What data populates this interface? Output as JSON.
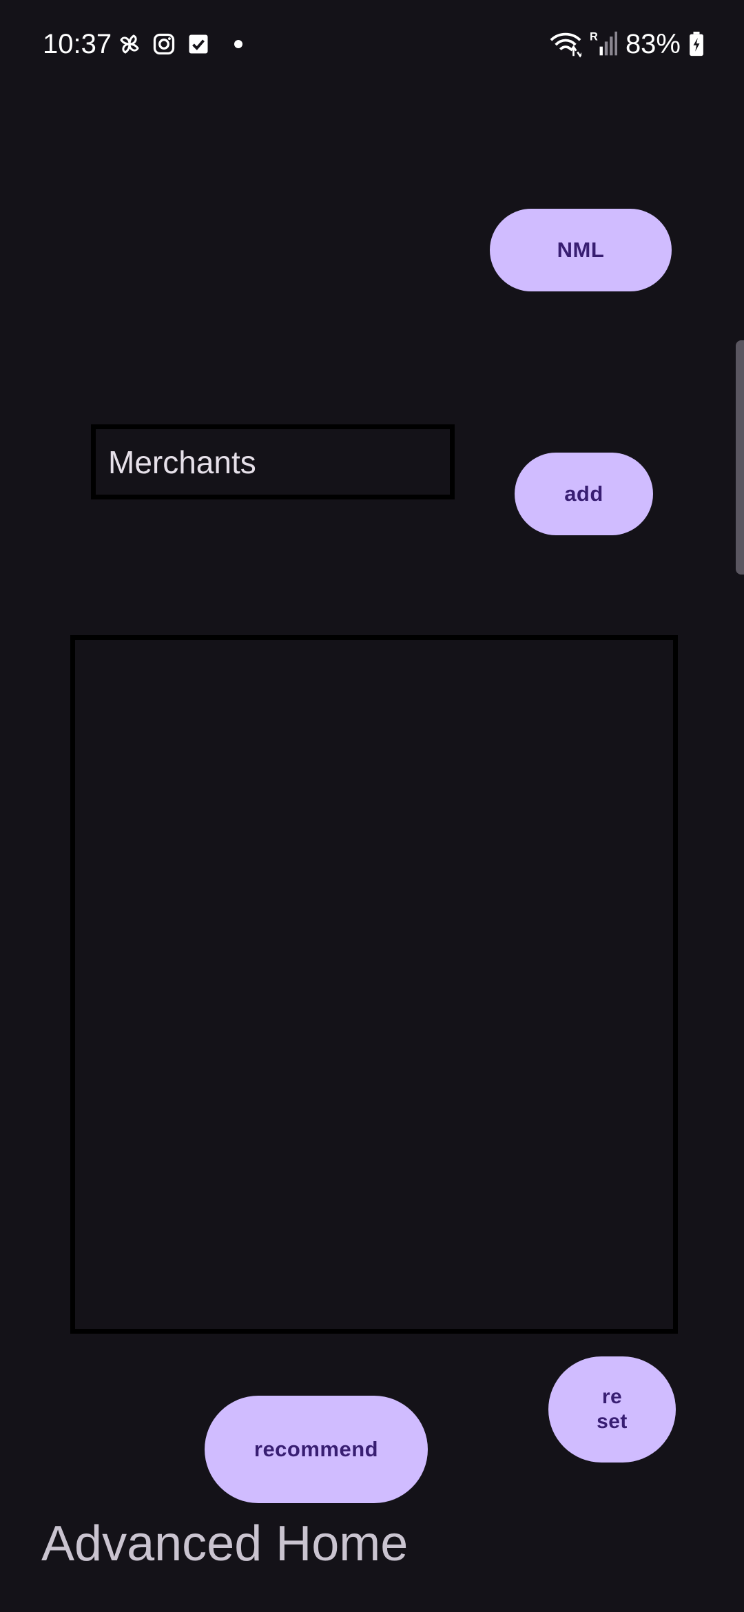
{
  "status_bar": {
    "time": "10:37",
    "left_icons": [
      "pinwheel-icon",
      "instagram-icon",
      "checkbox-icon",
      "notification-dot"
    ],
    "right_icons": [
      "wifi-icon",
      "signal-roaming-icon",
      "battery-charging-icon"
    ],
    "battery_percent": "83%"
  },
  "toolbar": {
    "nml_label": "NML"
  },
  "merchant_entry": {
    "placeholder": "Merchants",
    "value": "",
    "add_label": "add"
  },
  "merchant_list": {
    "items": []
  },
  "actions": {
    "reset_label": "re\nset",
    "recommend_label": "recommend"
  },
  "page": {
    "title": "Advanced Home"
  },
  "colors": {
    "background": "#141218",
    "button_fill": "#d0bcff",
    "button_text": "#381e72",
    "border": "#000000",
    "title_text": "#cac4d0"
  }
}
